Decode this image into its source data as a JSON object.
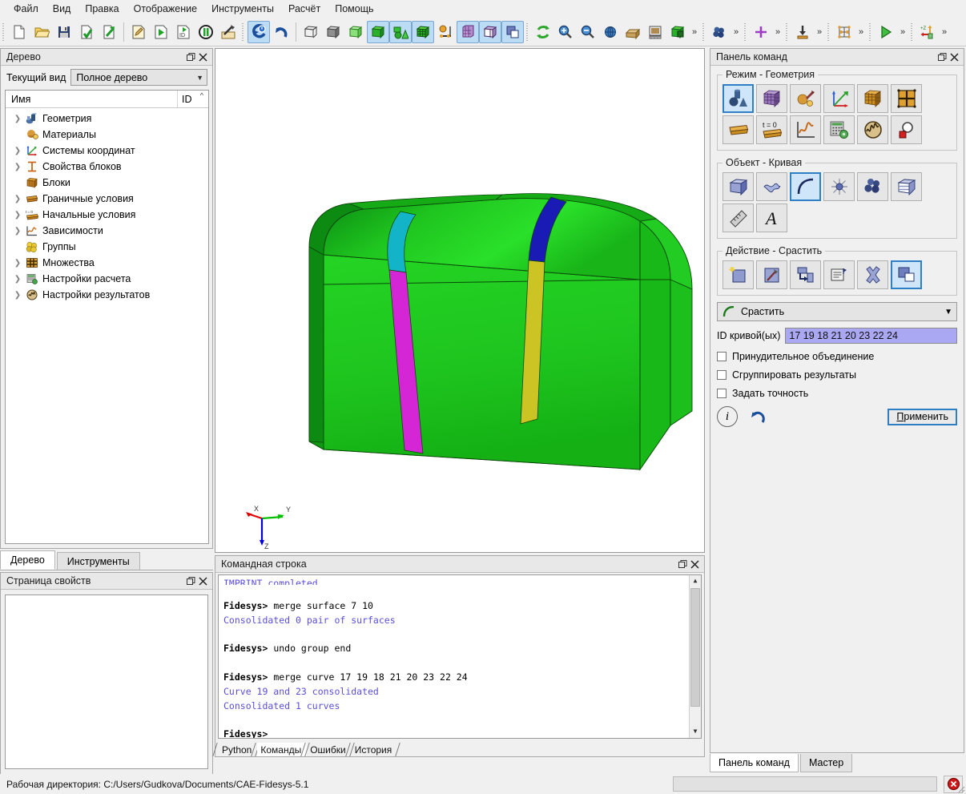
{
  "app": {
    "working_directory_label": "Рабочая директория: C:/Users/Gudkova/Documents/CAE-Fidesys-5.1"
  },
  "menubar": {
    "items": [
      {
        "label": "Файл",
        "name": "menu-file"
      },
      {
        "label": "Вид",
        "name": "menu-view"
      },
      {
        "label": "Правка",
        "name": "menu-edit"
      },
      {
        "label": "Отображение",
        "name": "menu-display"
      },
      {
        "label": "Инструменты",
        "name": "menu-tools"
      },
      {
        "label": "Расчёт",
        "name": "menu-calc"
      },
      {
        "label": "Помощь",
        "name": "menu-help"
      }
    ]
  },
  "toolbar": {
    "groups": [
      {
        "name": "file-group",
        "buttons": [
          {
            "name": "new-file-icon",
            "icon": "page"
          },
          {
            "name": "open-file-icon",
            "icon": "folder"
          },
          {
            "name": "save-file-icon",
            "icon": "floppy"
          },
          {
            "name": "import-icon",
            "icon": "page-check"
          },
          {
            "name": "export-icon",
            "icon": "page-arrow"
          },
          {
            "sep": true
          },
          {
            "name": "journal-edit-icon",
            "icon": "page-pencil"
          },
          {
            "name": "journal-play-icon",
            "icon": "page-play"
          },
          {
            "name": "journal-id-icon",
            "icon": "page-id"
          },
          {
            "name": "pause-icon",
            "icon": "pause"
          },
          {
            "name": "build-icon",
            "icon": "hammer"
          }
        ]
      },
      {
        "name": "undo-group",
        "buttons": [
          {
            "name": "reset-icon",
            "icon": "reset",
            "active": true
          },
          {
            "name": "undo-icon",
            "icon": "undo"
          },
          {
            "sep": true
          },
          {
            "name": "wireframe-icon",
            "icon": "cube-wire"
          },
          {
            "name": "hiddenline-icon",
            "icon": "cube-gray"
          },
          {
            "name": "transparent-icon",
            "icon": "cube-green-t"
          },
          {
            "name": "smoothshade-icon",
            "icon": "cube-green",
            "active": true
          },
          {
            "name": "geometry-mode-icon",
            "icon": "geom-shapes",
            "active": true
          },
          {
            "name": "mesh-mode-icon",
            "icon": "cube-mesh",
            "active": true
          },
          {
            "name": "compare-icon",
            "icon": "balance"
          },
          {
            "name": "grid-icon",
            "icon": "grid-3d",
            "active": true
          },
          {
            "name": "section-icon",
            "icon": "cube-purple",
            "active": true
          },
          {
            "name": "overlap-icon",
            "icon": "overlap",
            "active": true
          }
        ]
      },
      {
        "name": "view-group",
        "buttons": [
          {
            "name": "refresh-icon",
            "icon": "refresh"
          },
          {
            "name": "zoom-in-icon",
            "icon": "zoom-in"
          },
          {
            "name": "zoom-out-icon",
            "icon": "zoom-out"
          },
          {
            "name": "rotate-icon",
            "icon": "globe"
          },
          {
            "name": "extrude-icon",
            "icon": "beam"
          },
          {
            "name": "ruler-view-icon",
            "icon": "scale"
          },
          {
            "name": "fit-view-icon",
            "icon": "cube-fit"
          }
        ],
        "more": "»"
      },
      {
        "name": "group-select-group",
        "buttons": [
          {
            "name": "group-icon",
            "icon": "spheres"
          }
        ],
        "more": "»"
      },
      {
        "name": "marker-group",
        "buttons": [
          {
            "name": "crosshair-icon",
            "icon": "cross"
          }
        ],
        "more": "»"
      },
      {
        "name": "load-group",
        "buttons": [
          {
            "name": "load-arrow-icon",
            "icon": "down-arrow-bar"
          }
        ],
        "more": "»"
      },
      {
        "name": "mesh-edit-group",
        "buttons": [
          {
            "name": "nodes-icon",
            "icon": "node-net"
          }
        ],
        "more": "»"
      },
      {
        "name": "run-group",
        "buttons": [
          {
            "name": "run-icon",
            "icon": "play-green"
          }
        ],
        "more": "»"
      },
      {
        "name": "axis-group",
        "buttons": [
          {
            "name": "z-axis-icon",
            "icon": "zaxis"
          }
        ],
        "more": "»"
      }
    ]
  },
  "tree_panel": {
    "title": "Дерево",
    "current_view_label": "Текущий вид",
    "current_view_value": "Полное дерево",
    "columns": {
      "name": "Имя",
      "id": "ID"
    },
    "items": [
      {
        "label": "Геометрия",
        "expandable": true,
        "icon": "geometry-icon"
      },
      {
        "label": "Материалы",
        "expandable": false,
        "icon": "materials-icon"
      },
      {
        "label": "Системы координат",
        "expandable": true,
        "icon": "coordsys-icon"
      },
      {
        "label": "Свойства блоков",
        "expandable": true,
        "icon": "blockprops-icon"
      },
      {
        "label": "Блоки",
        "expandable": false,
        "icon": "blocks-icon"
      },
      {
        "label": "Граничные условия",
        "expandable": true,
        "icon": "boundary-icon"
      },
      {
        "label": "Начальные условия",
        "expandable": true,
        "icon": "initial-icon"
      },
      {
        "label": "Зависимости",
        "expandable": true,
        "icon": "dependency-icon"
      },
      {
        "label": "Группы",
        "expandable": false,
        "icon": "groups-icon"
      },
      {
        "label": "Множества",
        "expandable": true,
        "icon": "sets-icon"
      },
      {
        "label": "Настройки расчета",
        "expandable": true,
        "icon": "calc-settings-icon"
      },
      {
        "label": "Настройки результатов",
        "expandable": true,
        "icon": "result-settings-icon"
      }
    ],
    "tabs": [
      {
        "label": "Дерево",
        "selected": true
      },
      {
        "label": "Инструменты",
        "selected": false
      }
    ]
  },
  "property_panel": {
    "title": "Страница свойств"
  },
  "viewport": {
    "axis_labels": {
      "x": "X",
      "y": "Y",
      "z": "Z"
    },
    "model_colors": {
      "body_light": "#22d422",
      "body_mid": "#14bf14",
      "body_dark": "#0f9c18",
      "curve_cyan": "#14b4c8",
      "curve_magenta": "#d426d4",
      "curve_blue": "#1a1ab4",
      "curve_yellow": "#ccc425"
    }
  },
  "console": {
    "title": "Командная строка",
    "lines": [
      {
        "type": "clipped",
        "text": "IMPRINT completed."
      },
      {
        "type": "blank",
        "text": ""
      },
      {
        "type": "cmd",
        "prompt": "Fidesys>",
        "text": " merge surface 7 10"
      },
      {
        "type": "resp",
        "text": "Consolidated 0 pair of surfaces"
      },
      {
        "type": "blank",
        "text": ""
      },
      {
        "type": "cmd",
        "prompt": "Fidesys>",
        "text": " undo group end"
      },
      {
        "type": "blank",
        "text": ""
      },
      {
        "type": "cmd",
        "prompt": "Fidesys>",
        "text": " merge curve 17 19 18 21 20 23 22 24"
      },
      {
        "type": "resp",
        "text": "Curve 19 and 23 consolidated"
      },
      {
        "type": "resp",
        "text": "Consolidated 1 curves"
      },
      {
        "type": "blank",
        "text": ""
      },
      {
        "type": "cmd",
        "prompt": "Fidesys>",
        "text": ""
      }
    ],
    "tabs": [
      {
        "label": "Python",
        "selected": false
      },
      {
        "label": "Команды",
        "selected": true
      },
      {
        "label": "Ошибки",
        "selected": false
      },
      {
        "label": "История",
        "selected": false
      }
    ]
  },
  "command_panel": {
    "title": "Панель команд",
    "mode_group": {
      "legend": "Режим - Геометрия",
      "buttons": [
        {
          "name": "mode-geometry-icon",
          "icon": "shapes-blue",
          "selected": true
        },
        {
          "name": "mode-mesh-icon",
          "icon": "cube-purple-mesh",
          "selected": false
        },
        {
          "name": "mode-material-icon",
          "icon": "wrench-ball",
          "selected": false
        },
        {
          "name": "mode-coordsys-icon",
          "icon": "axes-rgb",
          "selected": false
        },
        {
          "name": "mode-blocks-icon",
          "icon": "cube-orange-mesh",
          "selected": false
        },
        {
          "name": "mode-sets-icon",
          "icon": "grid-orange",
          "selected": false
        },
        {
          "name": "mode-boundary-icon",
          "icon": "plate-orange",
          "selected": false
        },
        {
          "name": "mode-initial-icon",
          "icon": "t-zero",
          "selected": false
        },
        {
          "name": "mode-dependency-icon",
          "icon": "curve-plot",
          "selected": false
        },
        {
          "name": "mode-calc-icon",
          "icon": "calculator-gear",
          "selected": false
        },
        {
          "name": "mode-results-icon",
          "icon": "wave-disc",
          "selected": false
        },
        {
          "name": "mode-inspect-icon",
          "icon": "magnify-red",
          "selected": false
        }
      ]
    },
    "object_group": {
      "legend": "Объект - Кривая",
      "buttons": [
        {
          "name": "object-volume-icon",
          "icon": "cube-blue",
          "selected": false
        },
        {
          "name": "object-surface-icon",
          "icon": "surface-diamond",
          "selected": false
        },
        {
          "name": "object-curve-icon",
          "icon": "curve-arc",
          "selected": true
        },
        {
          "name": "object-vertex-icon",
          "icon": "vertex-star",
          "selected": false
        },
        {
          "name": "object-group-icon",
          "icon": "spheres-blue",
          "selected": false
        },
        {
          "name": "object-body-icon",
          "icon": "cube-striped",
          "selected": false
        },
        {
          "name": "object-ruler-icon",
          "icon": "ruler",
          "selected": false
        },
        {
          "name": "object-text-icon",
          "icon": "letter-a",
          "selected": false
        }
      ]
    },
    "action_group": {
      "legend": "Действие - Срастить",
      "buttons": [
        {
          "name": "action-create-icon",
          "icon": "sparkle-square",
          "selected": false
        },
        {
          "name": "action-modify-icon",
          "icon": "hammer-square",
          "selected": false
        },
        {
          "name": "action-move-icon",
          "icon": "move-square",
          "selected": false
        },
        {
          "name": "action-attributes-icon",
          "icon": "list-square",
          "selected": false
        },
        {
          "name": "action-delete-icon",
          "icon": "x-mark",
          "selected": false
        },
        {
          "name": "action-merge-icon",
          "icon": "merge-squares",
          "selected": true
        }
      ]
    },
    "operation_combo": {
      "value": "Срастить",
      "icon": "curve-arc-icon"
    },
    "curve_ids": {
      "label": "ID кривой(ых)",
      "value": "17 19 18 21 20 23 22 24"
    },
    "checkboxes": [
      {
        "label": "Принудительное объединение",
        "checked": false,
        "name": "force-merge-checkbox"
      },
      {
        "label": "Сгруппировать результаты",
        "checked": false,
        "name": "group-results-checkbox"
      },
      {
        "label": "Задать точность",
        "checked": false,
        "name": "set-tolerance-checkbox"
      }
    ],
    "info_button": "i",
    "reset_button": "↺",
    "apply_button": {
      "underlined": "П",
      "rest": "рименить"
    },
    "tabs": [
      {
        "label": "Панель команд",
        "selected": true
      },
      {
        "label": "Мастер",
        "selected": false
      }
    ]
  }
}
